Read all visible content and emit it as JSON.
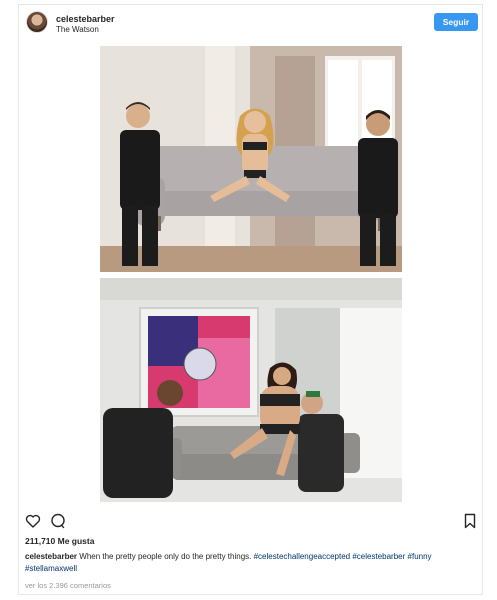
{
  "post": {
    "username": "celestebarber",
    "location": "The Watson",
    "follow_label": "Seguir",
    "likes": "211,710 Me gusta",
    "caption": {
      "username": "celestebarber",
      "text": "When the pretty people only do the pretty things.",
      "hashtags": [
        "#celestechallengeaccepted",
        "#celestebarber",
        "#funny",
        "#stellamaxwell"
      ]
    },
    "comments_link": "ver los 2.396 comentarios"
  },
  "icons": {
    "like": "heart-icon",
    "comment": "comment-bubble-icon",
    "save": "bookmark-icon"
  },
  "colors": {
    "follow_button": "#3897f0",
    "hashtag": "#003569",
    "muted_text": "#999999"
  }
}
